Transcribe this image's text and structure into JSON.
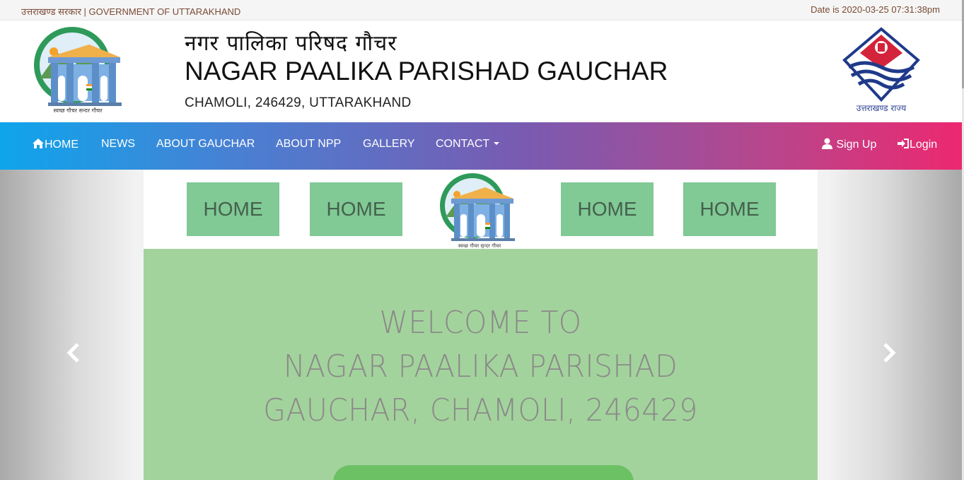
{
  "topbar": {
    "gov_label": "उत्तराखण्ड सरकार | GOVERNMENT OF UTTARAKHAND",
    "date_text": "Date is 2020-03-25 07:31:38pm"
  },
  "header": {
    "title_hindi": "नगर पालिका परिषद गौचर",
    "title_english": "NAGAR PAALIKA PARISHAD GAUCHAR",
    "subtitle": "CHAMOLI, 246429, UTTARAKHAND",
    "left_logo_caption": "स्वच्छ गौचर सुन्दर गौचर",
    "right_logo_caption": "उत्तराखण्ड राज्य"
  },
  "nav": {
    "home": "HOME",
    "news": "NEWS",
    "about_gauchar": "ABOUT GAUCHAR",
    "about_npp": "ABOUT NPP",
    "gallery": "GALLERY",
    "contact": "CONTACT",
    "signup": "Sign Up",
    "login": "Login"
  },
  "slide": {
    "buttons": [
      "HOME",
      "HOME",
      "HOME",
      "HOME"
    ],
    "welcome_lines": [
      "WELCOME TO",
      "NAGAR PAALIKA PARISHAD",
      "GAUCHAR, CHAMOLI, 246429"
    ]
  },
  "colors": {
    "nav_gradient_start": "#0ea5ec",
    "nav_gradient_end": "#ec2870",
    "home_button": "#81c995",
    "panel_green": "#a3d39c"
  }
}
